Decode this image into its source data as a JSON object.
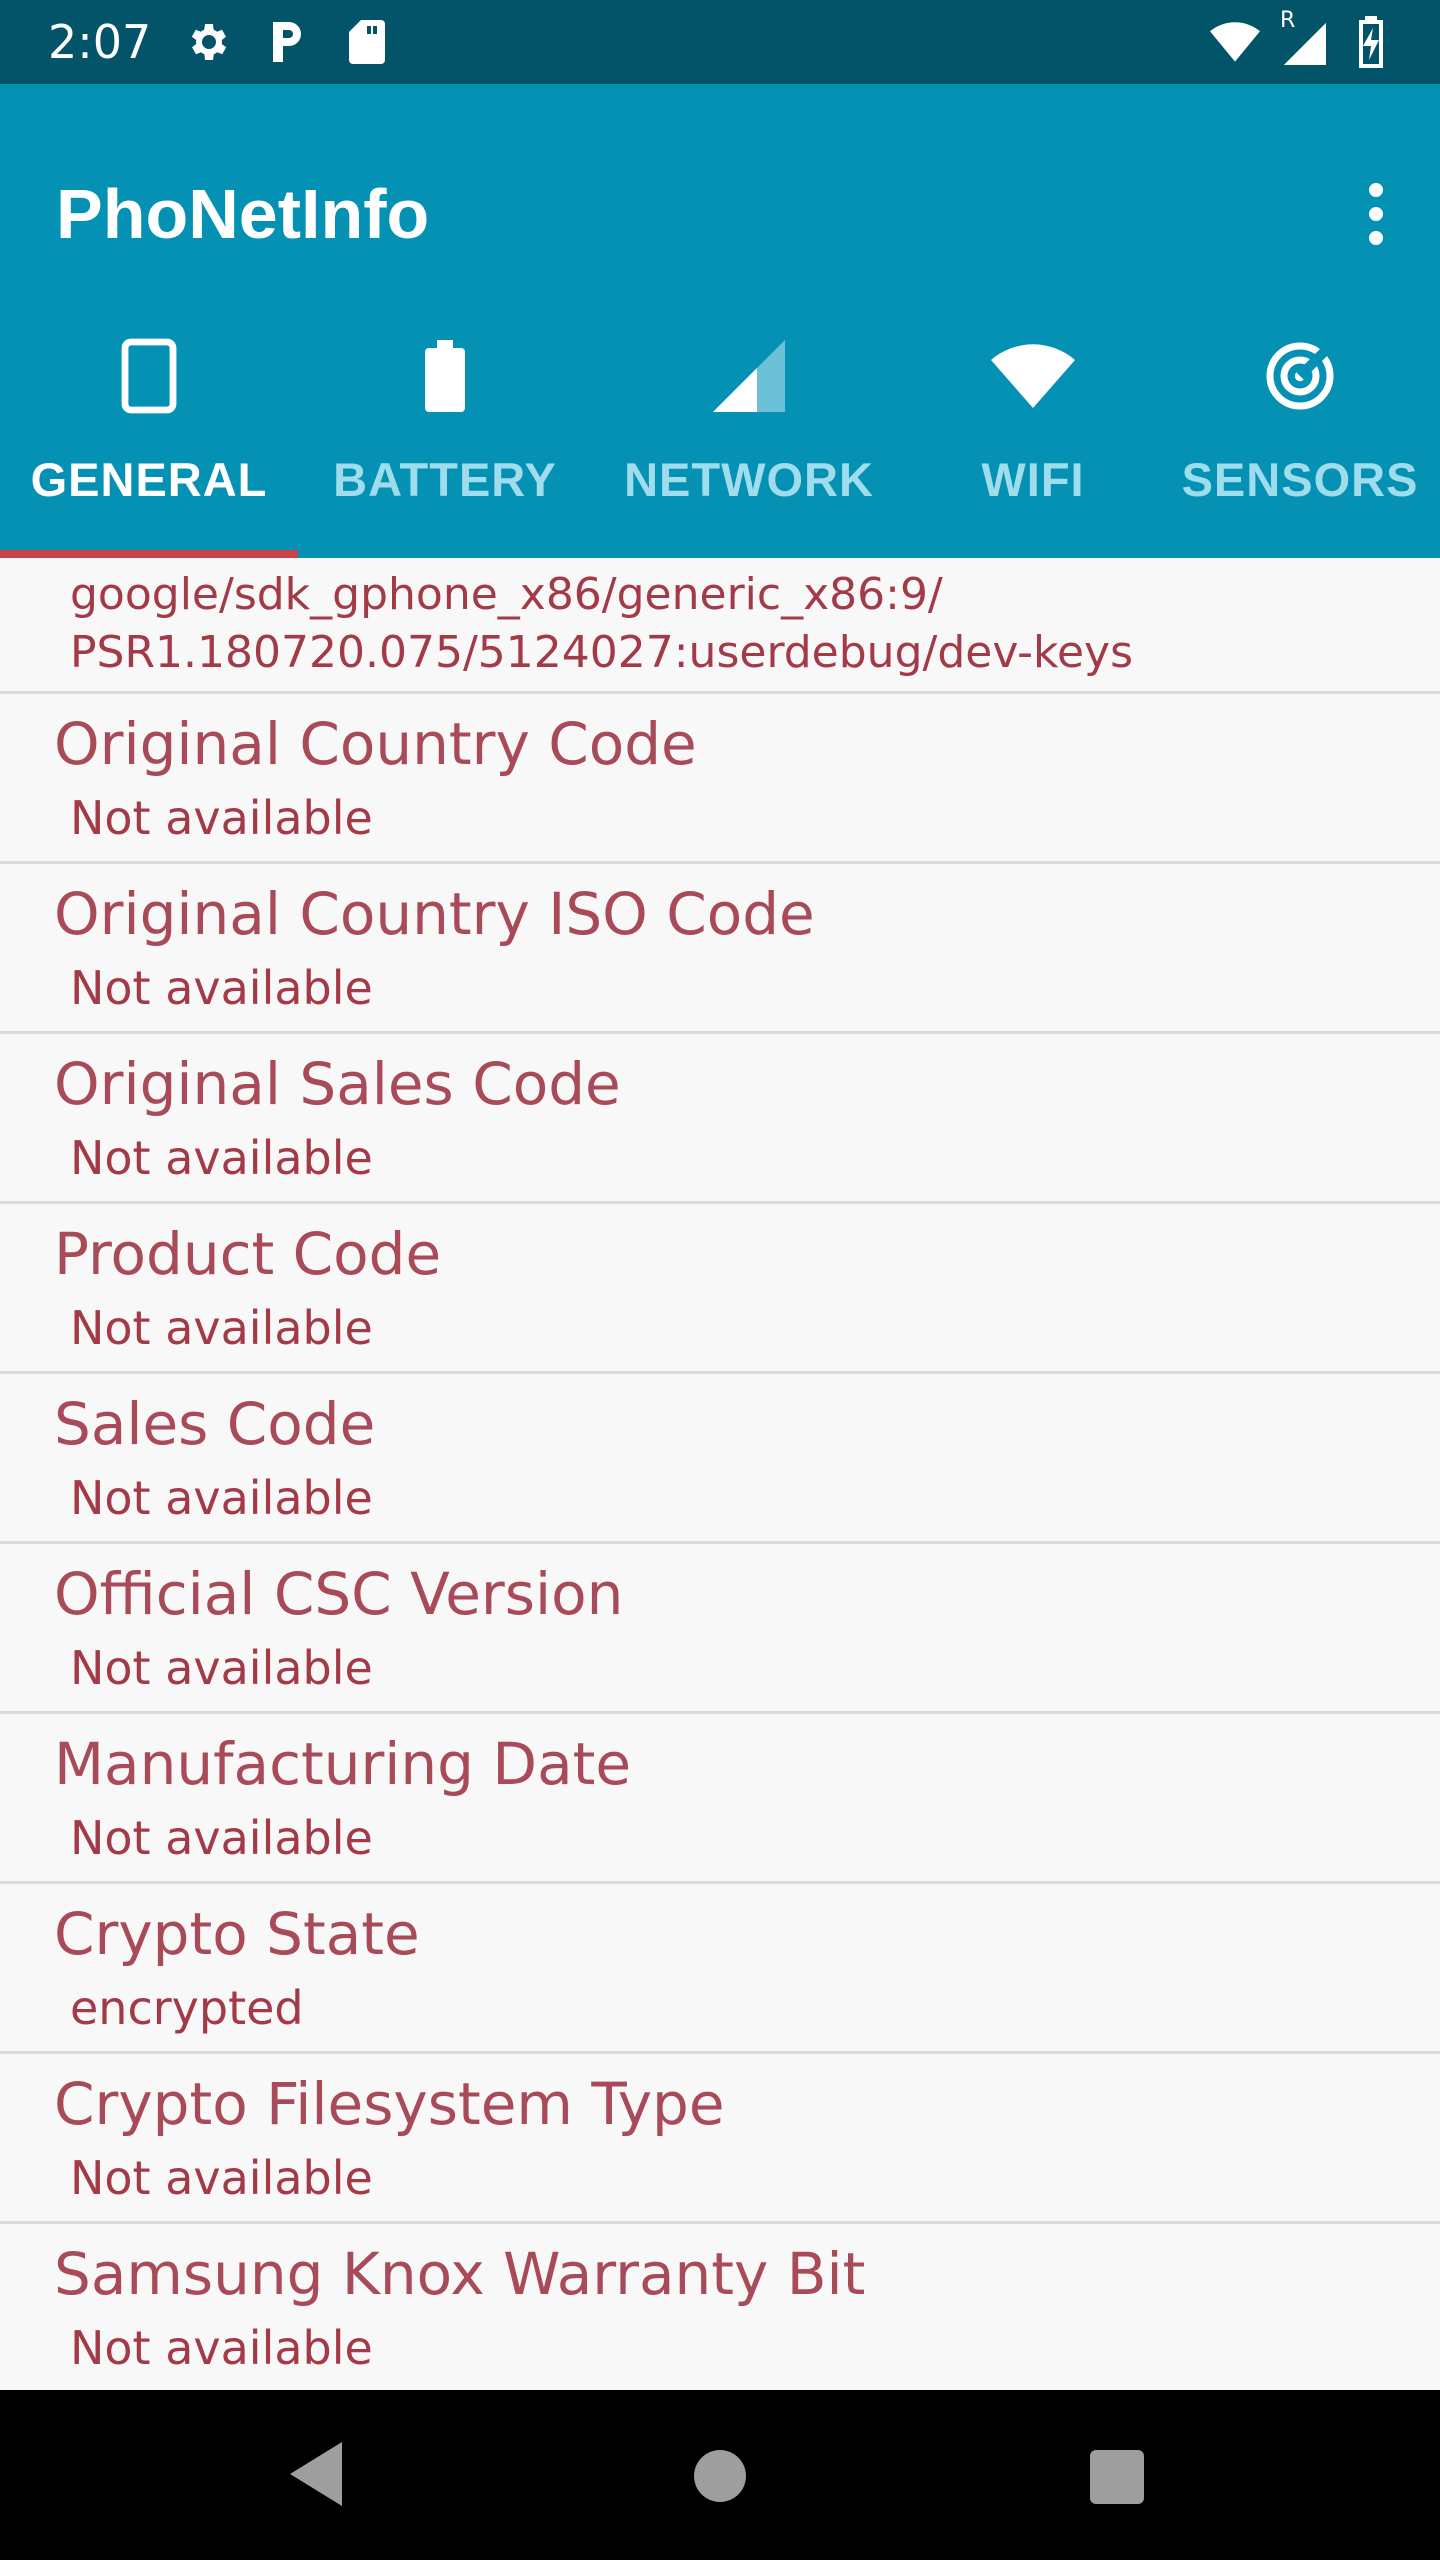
{
  "status_bar": {
    "time": "2:07",
    "left_icons": [
      "gear-icon",
      "parking-icon",
      "sd-card-icon"
    ],
    "right_icons": [
      "wifi-icon",
      "roaming-signal-icon",
      "battery-charging-icon"
    ],
    "roaming_label": "R"
  },
  "app_bar": {
    "title": "PhoNetInfo",
    "menu_icon": "overflow-menu-icon"
  },
  "tabs": [
    {
      "label": "GENERAL",
      "icon": "phone-icon",
      "active": true
    },
    {
      "label": "BATTERY",
      "icon": "battery-icon",
      "active": false
    },
    {
      "label": "NETWORK",
      "icon": "signal-icon",
      "active": false
    },
    {
      "label": "WIFI",
      "icon": "wifi-icon",
      "active": false
    },
    {
      "label": "SENSORS",
      "icon": "sensor-icon",
      "active": false
    }
  ],
  "content": {
    "top_value_line1": "google/sdk_gphone_x86/generic_x86:9/",
    "top_value_line2": "PSR1.180720.075/5124027:userdebug/dev-keys",
    "items": [
      {
        "title": "Original Country Code",
        "value": "Not available"
      },
      {
        "title": "Original Country ISO Code",
        "value": "Not available"
      },
      {
        "title": "Original Sales Code",
        "value": "Not available"
      },
      {
        "title": "Product Code",
        "value": "Not available"
      },
      {
        "title": "Sales Code",
        "value": "Not available"
      },
      {
        "title": "Official CSC Version",
        "value": "Not available"
      },
      {
        "title": "Manufacturing Date",
        "value": "Not available"
      },
      {
        "title": "Crypto State",
        "value": "encrypted"
      },
      {
        "title": "Crypto Filesystem Type",
        "value": "Not available"
      },
      {
        "title": "Samsung Knox Warranty Bit",
        "value": "Not available"
      }
    ]
  },
  "nav_bar": {
    "back_icon": "back-icon",
    "home_icon": "home-icon",
    "recents_icon": "recents-icon"
  },
  "colors": {
    "status_bar": "#035369",
    "app_bar": "#0491b3",
    "tab_indicator": "#c9444d",
    "item_text": "#a84a58",
    "background": "#f8f8f9"
  }
}
